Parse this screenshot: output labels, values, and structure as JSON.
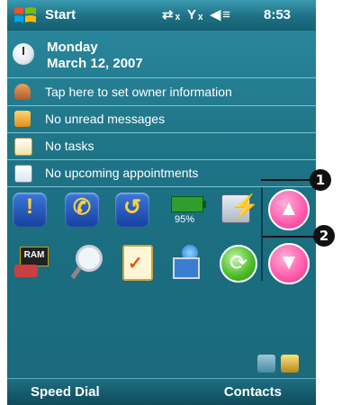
{
  "titlebar": {
    "title": "Start",
    "time": "8:53",
    "status_icons": [
      "connectivity-icon",
      "no-signal-icon",
      "volume-icon"
    ]
  },
  "today": {
    "day": "Monday",
    "date": "March 12, 2007",
    "owner": "Tap here to set owner information",
    "messages": "No unread messages",
    "tasks": "No tasks",
    "appointments": "No upcoming appointments"
  },
  "launcher": {
    "battery_label": "95%",
    "ram_label": "RAM"
  },
  "callouts": [
    "1",
    "2"
  ],
  "softkeys": {
    "left": "Speed Dial",
    "right": "Contacts"
  }
}
